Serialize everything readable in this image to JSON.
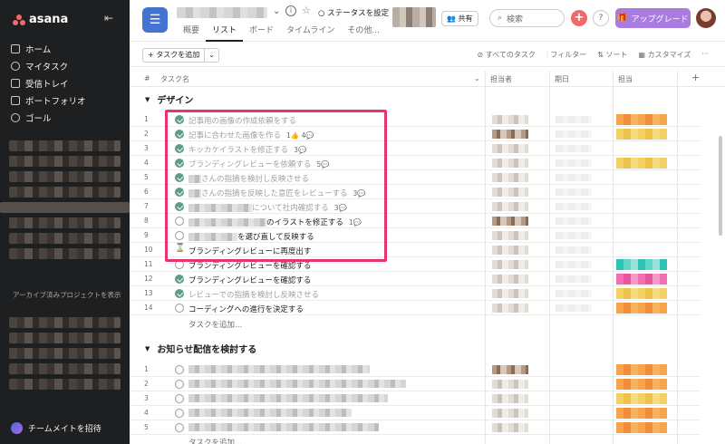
{
  "sidebar": {
    "logo_text": "asana",
    "nav": [
      {
        "label": "ホーム",
        "icon": "home-icon"
      },
      {
        "label": "マイタスク",
        "icon": "check-circle-icon"
      },
      {
        "label": "受信トレイ",
        "icon": "bell-icon"
      },
      {
        "label": "ポートフォリオ",
        "icon": "chart-icon"
      },
      {
        "label": "ゴール",
        "icon": "person-icon"
      }
    ],
    "archive_link": "アーカイブ済みプロジェクトを表示",
    "invite": "チームメイトを招待"
  },
  "header": {
    "status": "○ ステータスを設定",
    "share": "共有",
    "search_placeholder": "検索",
    "help": "?",
    "upgrade": "アップグレード",
    "tabs": [
      "概要",
      "リスト",
      "ボード",
      "タイムライン",
      "その他..."
    ],
    "active_tab": "リスト"
  },
  "toolbar": {
    "add_task": "+ タスクを追加",
    "all_tasks": "すべてのタスク",
    "filter": "フィルター",
    "sort": "ソート",
    "customize": "カスタマイズ"
  },
  "columns": {
    "num": "#",
    "task": "タスク名",
    "assignee": "担当者",
    "due": "期日",
    "owner": "担当",
    "add": "+"
  },
  "section1": {
    "title": "デザイン",
    "rows": [
      {
        "n": "1",
        "name": "記事用の画像の作成依頼をする",
        "meta": "",
        "done": true
      },
      {
        "n": "2",
        "name": "記事に合わせた画像を作る",
        "meta": "1👍 4💬",
        "done": true
      },
      {
        "n": "3",
        "name": "キッカケイラストを修正する",
        "meta": "3💬",
        "done": true
      },
      {
        "n": "4",
        "name": "ブランディングレビューを依頼する",
        "meta": "5💬",
        "done": true
      },
      {
        "n": "5",
        "name": "さんの指摘を検討し反映させる",
        "meta": "",
        "done": true
      },
      {
        "n": "6",
        "name": "さんの指摘を反映した意匠をレビューする",
        "meta": "3💬",
        "done": true
      },
      {
        "n": "7",
        "name": "について社内確認する",
        "meta": "3💬",
        "done": true
      },
      {
        "n": "8",
        "name": "のイラストを修正する",
        "meta": "1💬",
        "done": false
      },
      {
        "n": "9",
        "name": "を選び直して反映する",
        "meta": "",
        "done": false
      },
      {
        "n": "10",
        "name": "ブランディングレビューに再度出す",
        "meta": "",
        "done": false
      },
      {
        "n": "11",
        "name": "ブランディングレビューを確認する",
        "meta": "",
        "done": false
      },
      {
        "n": "12",
        "name": "ブランディングレビューを確認する",
        "meta": "",
        "done": true
      },
      {
        "n": "13",
        "name": "レビューでの指摘を検討し反映させる",
        "meta": "",
        "done": true
      },
      {
        "n": "14",
        "name": "コーディングへの進行を決定する",
        "meta": "",
        "done": false
      }
    ],
    "add_task": "タスクを追加..."
  },
  "section2": {
    "title": "お知らせ配信を検討する",
    "rows": [
      "1",
      "2",
      "3",
      "4",
      "5"
    ],
    "add_task": "タスクを追加..."
  }
}
